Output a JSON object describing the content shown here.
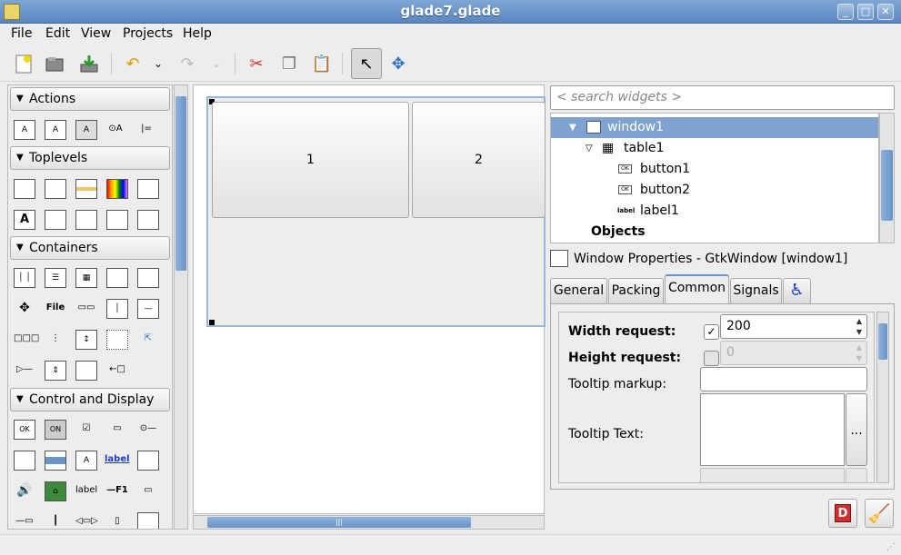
{
  "window": {
    "title": "glade7.glade"
  },
  "menu": [
    "File",
    "Edit",
    "View",
    "Projects",
    "Help"
  ],
  "palette": {
    "groups": [
      "Actions",
      "Toplevels",
      "Containers",
      "Control and Display"
    ],
    "actions_icons": [
      "A",
      "A",
      "A",
      "⊙A",
      "|="
    ],
    "containers_row2": [
      "✥",
      "File",
      "▭▭",
      "",
      ""
    ],
    "control_icons": [
      "OK",
      "ON",
      "☑",
      "▭",
      "⊙—",
      "",
      "",
      "A",
      "label",
      "",
      "🔊",
      "",
      "label",
      "—F1",
      "▭"
    ]
  },
  "canvas": {
    "button1_label": "1",
    "button2_label": "2"
  },
  "search": {
    "placeholder": "< search widgets >"
  },
  "tree": {
    "items": [
      {
        "label": "window1"
      },
      {
        "label": "table1"
      },
      {
        "label": "button1",
        "icon": "OK"
      },
      {
        "label": "button2",
        "icon": "OK"
      },
      {
        "label": "label1",
        "icon": "label"
      }
    ],
    "objects_label": "Objects"
  },
  "properties": {
    "title": "Window Properties - GtkWindow [window1]",
    "tabs": [
      "General",
      "Packing",
      "Common",
      "Signals"
    ],
    "width_request_label": "Width request:",
    "width_request_value": "200",
    "width_request_checked": "✓",
    "height_request_label": "Height request:",
    "height_request_value": "0",
    "tooltip_markup_label": "Tooltip markup:",
    "tooltip_text_label": "Tooltip Text:",
    "ellipsis": "..."
  },
  "colors": {
    "selection": "#7ea3d1",
    "titlebar": "#6a93c7",
    "accent": "#d32f2f"
  }
}
